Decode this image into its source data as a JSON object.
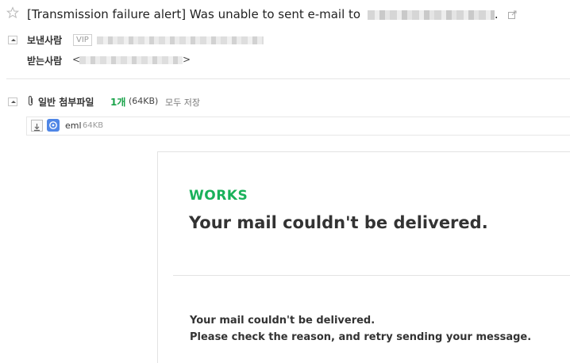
{
  "subject": {
    "text": "[Transmission failure alert] Was unable to sent e-mail to",
    "end_punct": "."
  },
  "sender": {
    "label": "보낸사람",
    "vip_badge": "VIP"
  },
  "recipient": {
    "label": "받는사람",
    "open_bracket": "<",
    "close_bracket": ">"
  },
  "attachments": {
    "title": "일반 첨부파일",
    "count": "1개",
    "size": "(64KB)",
    "save_all": "모두 저장",
    "files": [
      {
        "name": "eml",
        "size": "64KB"
      }
    ]
  },
  "message": {
    "brand": "WORKS",
    "headline": "Your mail couldn't be delivered.",
    "line1": "Your mail couldn't be delivered.",
    "line2": "Please check the reason, and retry sending your message."
  },
  "colors": {
    "brand_green": "#19b15a",
    "count_green": "#1aa34a",
    "file_badge": "#4f86e6"
  }
}
